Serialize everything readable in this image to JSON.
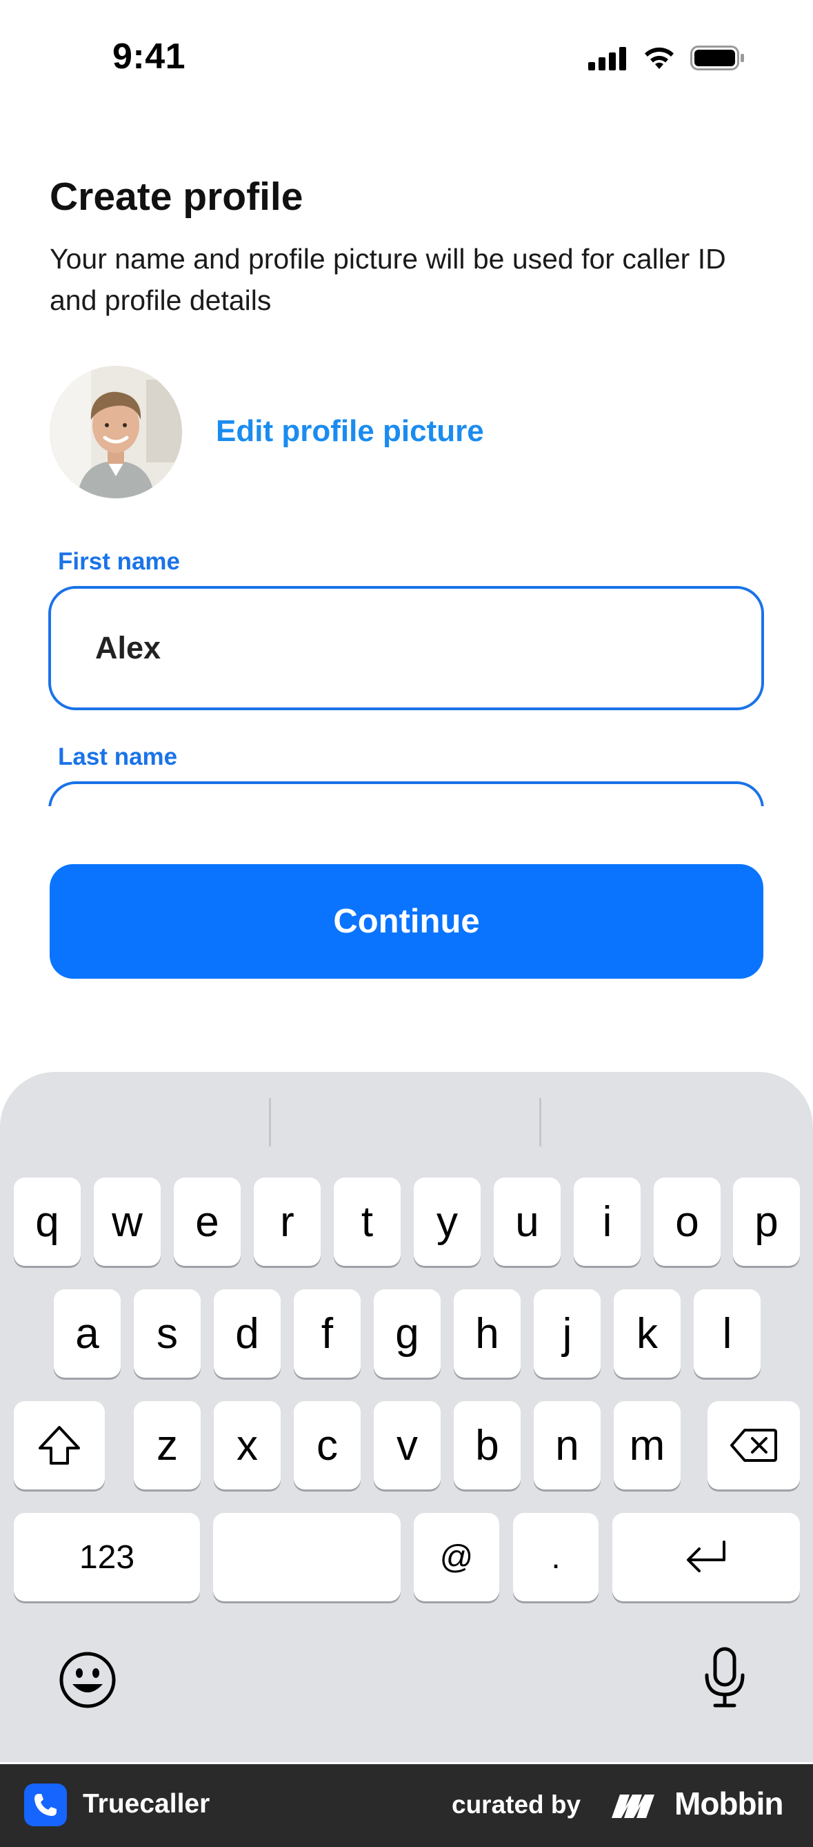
{
  "status_bar": {
    "time": "9:41"
  },
  "header": {
    "title": "Create profile",
    "subtitle": "Your name and profile picture will be used for caller ID and profile details"
  },
  "profile": {
    "edit_picture_label": "Edit profile picture"
  },
  "form": {
    "first_name_label": "First name",
    "first_name_value": "Alex",
    "last_name_label": "Last name",
    "last_name_value": ""
  },
  "continue_label": "Continue",
  "keyboard": {
    "row1": [
      "q",
      "w",
      "e",
      "r",
      "t",
      "y",
      "u",
      "i",
      "o",
      "p"
    ],
    "row2": [
      "a",
      "s",
      "d",
      "f",
      "g",
      "h",
      "j",
      "k",
      "l"
    ],
    "row3": [
      "z",
      "x",
      "c",
      "v",
      "b",
      "n",
      "m"
    ],
    "numbers_label": "123",
    "at_label": "@",
    "dot_label": "."
  },
  "footer": {
    "app_name": "Truecaller",
    "curated_label": "curated by",
    "brand": "Mobbin"
  },
  "colors": {
    "accent": "#1a73e8",
    "button": "#0a74ff",
    "link": "#1a8cf0",
    "keyboard_bg": "#dfe1e5",
    "footer_bg": "#2a2a2a"
  }
}
